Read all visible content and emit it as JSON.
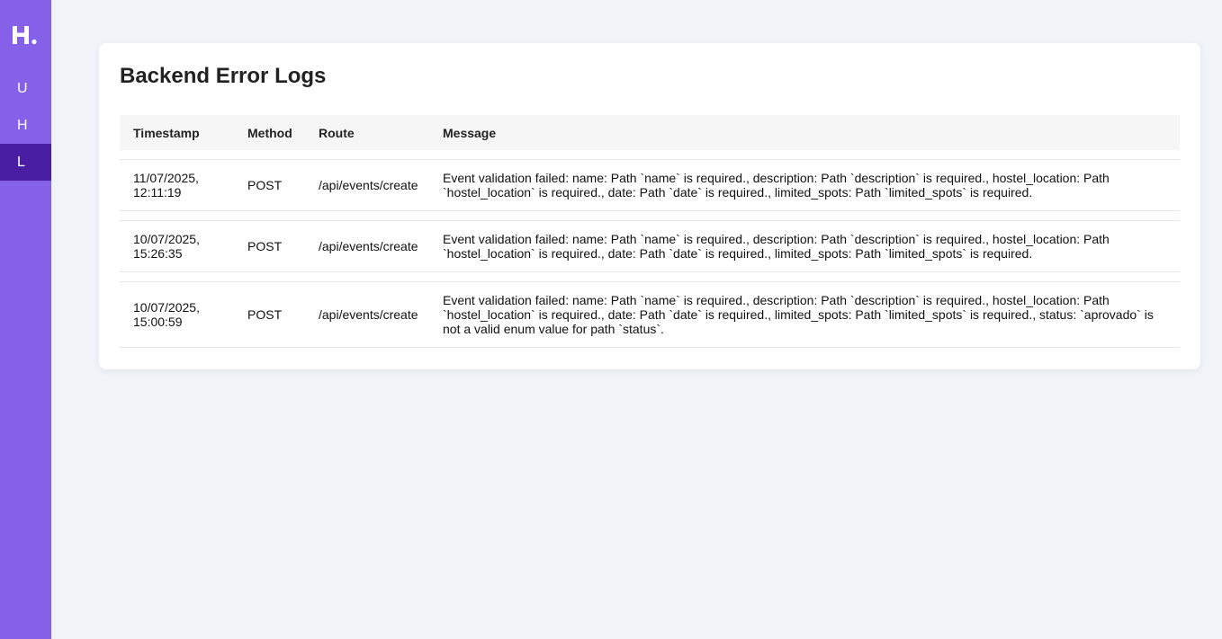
{
  "sidebar": {
    "logo": "H.",
    "items": [
      {
        "label": "U"
      },
      {
        "label": "H"
      },
      {
        "label": "L"
      }
    ],
    "active_color": "#4a1ea3",
    "bg_color": "#8560e8"
  },
  "main": {
    "title": "Backend Error Logs",
    "table": {
      "headers": [
        "Timestamp",
        "Method",
        "Route",
        "Message"
      ],
      "rows": [
        {
          "timestamp": "11/07/2025, 12:11:19",
          "method": "POST",
          "route": "/api/events/create",
          "message": "Event validation failed: name: Path `name` is required., description: Path `description` is required., hostel_location: Path `hostel_location` is required., date: Path `date` is required., limited_spots: Path `limited_spots` is required."
        },
        {
          "timestamp": "10/07/2025, 15:26:35",
          "method": "POST",
          "route": "/api/events/create",
          "message": "Event validation failed: name: Path `name` is required., description: Path `description` is required., hostel_location: Path `hostel_location` is required., date: Path `date` is required., limited_spots: Path `limited_spots` is required."
        },
        {
          "timestamp": "10/07/2025, 15:00:59",
          "method": "POST",
          "route": "/api/events/create",
          "message": "Event validation failed: name: Path `name` is required., description: Path `description` is required., hostel_location: Path `hostel_location` is required., date: Path `date` is required., limited_spots: Path `limited_spots` is required., status: `aprovado` is not a valid enum value for path `status`."
        }
      ]
    }
  }
}
